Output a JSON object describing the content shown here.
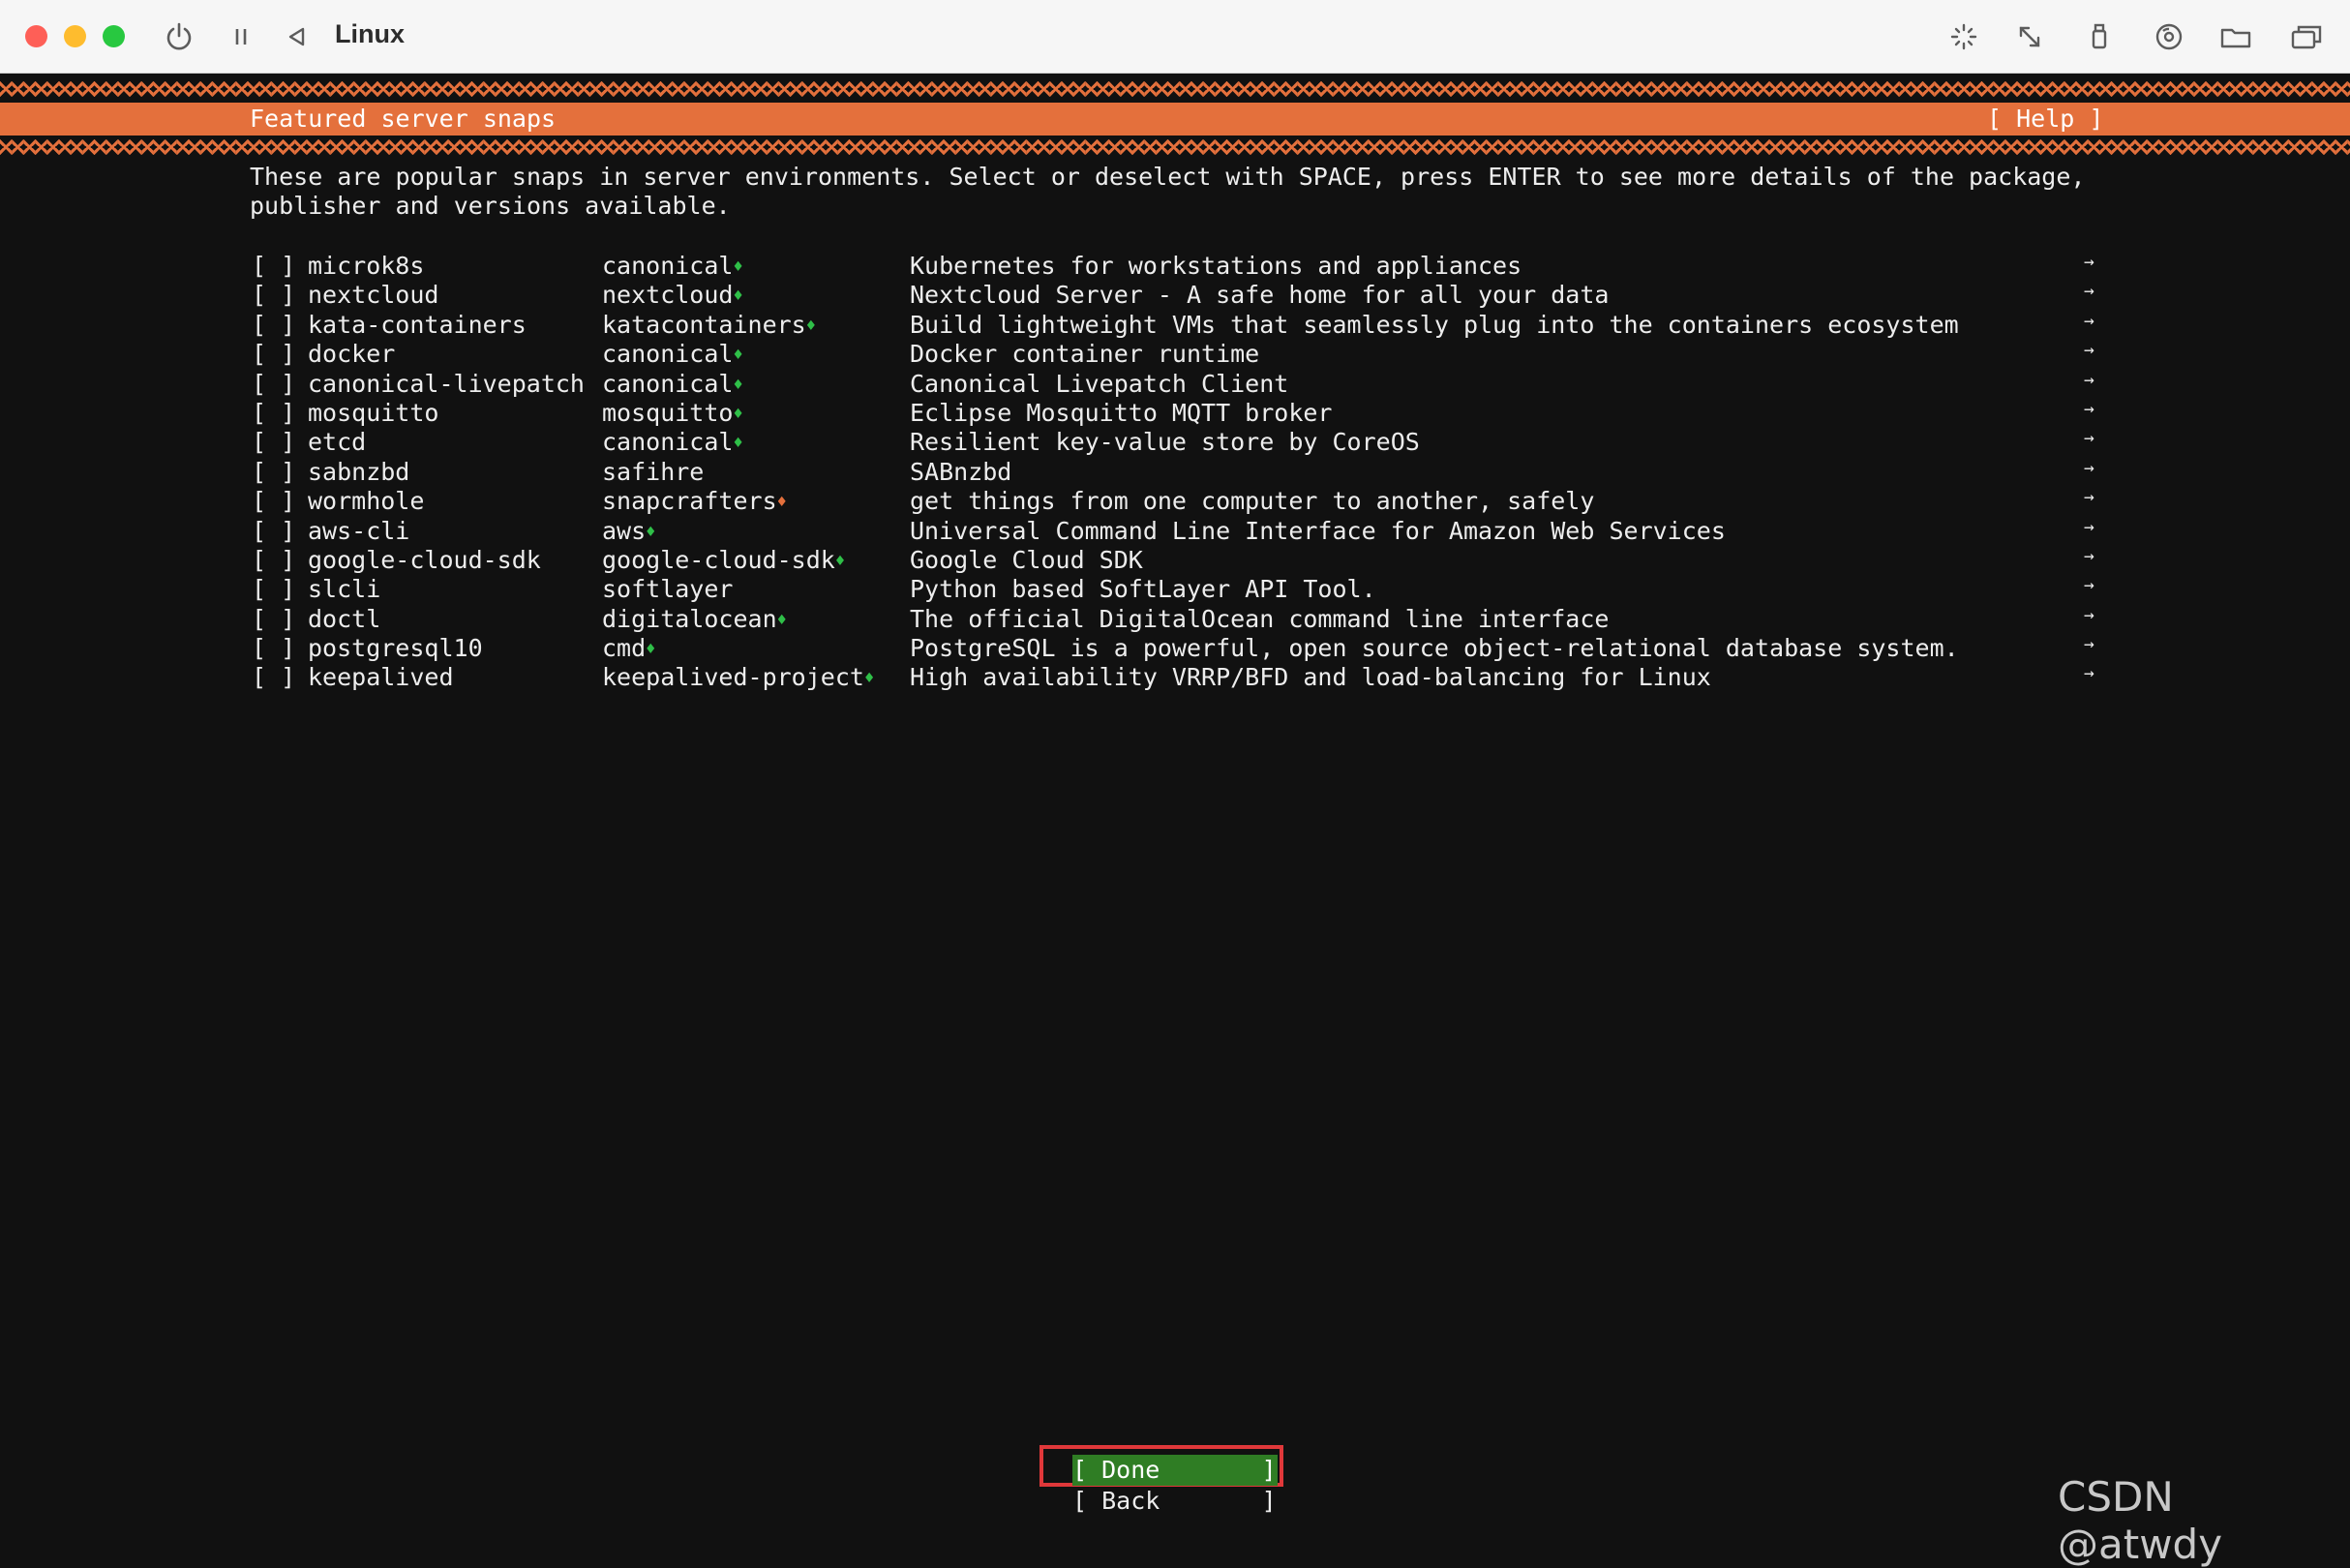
{
  "window": {
    "title": "Linux",
    "toolbar_icons": [
      "power-icon",
      "pause-icon",
      "back-triangle-icon",
      "brightness-icon",
      "resize-icon",
      "usb-icon",
      "disc-icon",
      "shared-folder-icon",
      "windows-icon"
    ]
  },
  "installer": {
    "header_title": "Featured server snaps",
    "help_label": "[ Help ]",
    "description_line1": "These are popular snaps in server environments. Select or deselect with SPACE, press ENTER to see more details of the package,",
    "description_line2": "publisher and versions available.",
    "checkbox_unchecked": "[ ]",
    "row_arrow": "→",
    "snaps": [
      {
        "name": "microk8s",
        "publisher": "canonical",
        "mark": "♦",
        "mark_type": "verified",
        "description": "Kubernetes for workstations and appliances"
      },
      {
        "name": "nextcloud",
        "publisher": "nextcloud",
        "mark": "♦",
        "mark_type": "verified",
        "description": "Nextcloud Server - A safe home for all your data"
      },
      {
        "name": "kata-containers",
        "publisher": "katacontainers",
        "mark": "♦",
        "mark_type": "verified",
        "description": "Build lightweight VMs that seamlessly plug into the containers ecosystem"
      },
      {
        "name": "docker",
        "publisher": "canonical",
        "mark": "♦",
        "mark_type": "verified",
        "description": "Docker container runtime"
      },
      {
        "name": "canonical-livepatch",
        "publisher": "canonical",
        "mark": "♦",
        "mark_type": "verified",
        "description": "Canonical Livepatch Client"
      },
      {
        "name": "mosquitto",
        "publisher": "mosquitto",
        "mark": "♦",
        "mark_type": "verified",
        "description": "Eclipse Mosquitto MQTT broker"
      },
      {
        "name": "etcd",
        "publisher": "canonical",
        "mark": "♦",
        "mark_type": "verified",
        "description": "Resilient key-value store by CoreOS"
      },
      {
        "name": "sabnzbd",
        "publisher": "safihre",
        "mark": "",
        "mark_type": "none",
        "description": "SABnzbd"
      },
      {
        "name": "wormhole",
        "publisher": "snapcrafters",
        "mark": "♦",
        "mark_type": "starred",
        "description": "get things from one computer to another, safely"
      },
      {
        "name": "aws-cli",
        "publisher": "aws",
        "mark": "♦",
        "mark_type": "verified",
        "description": "Universal Command Line Interface for Amazon Web Services"
      },
      {
        "name": "google-cloud-sdk",
        "publisher": "google-cloud-sdk",
        "mark": "♦",
        "mark_type": "verified",
        "description": "Google Cloud SDK"
      },
      {
        "name": "slcli",
        "publisher": "softlayer",
        "mark": "",
        "mark_type": "none",
        "description": "Python based SoftLayer API Tool."
      },
      {
        "name": "doctl",
        "publisher": "digitalocean",
        "mark": "♦",
        "mark_type": "verified",
        "description": "The official DigitalOcean command line interface"
      },
      {
        "name": "postgresql10",
        "publisher": "cmd",
        "mark": "♦",
        "mark_type": "verified",
        "description": "PostgreSQL is a powerful, open source object-relational database system."
      },
      {
        "name": "keepalived",
        "publisher": "keepalived-project",
        "mark": "♦",
        "mark_type": "verified",
        "description": "High availability VRRP/BFD and load-balancing for Linux"
      }
    ],
    "done_label": "[ Done       ]",
    "back_label": "[ Back       ]"
  },
  "colors": {
    "accent_orange": "#e4703c",
    "verified_green": "#2fbf48",
    "done_green": "#2f7d24",
    "highlight_red": "#e0383a",
    "terminal_bg": "#111111"
  },
  "watermark": "CSDN @atwdy"
}
